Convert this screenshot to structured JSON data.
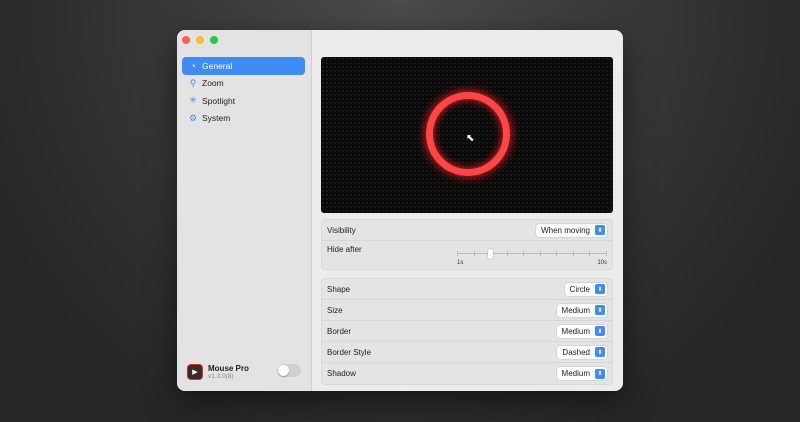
{
  "sidebar": {
    "items": [
      {
        "label": "General",
        "icon": "gauge-icon",
        "glyph": "◔"
      },
      {
        "label": "Zoom",
        "icon": "zoom-icon",
        "glyph": "⚲"
      },
      {
        "label": "Spotlight",
        "icon": "spotlight-icon",
        "glyph": "✳"
      },
      {
        "label": "System",
        "icon": "gear-icon",
        "glyph": "⚙"
      }
    ],
    "app": {
      "name": "Mouse Pro",
      "version": "v1.3.0(8)",
      "enabled": false
    }
  },
  "visibility": {
    "label": "Visibility",
    "value": "When moving"
  },
  "hide_after": {
    "label": "Hide after",
    "min_label": "1s",
    "max_label": "10s",
    "min": 1,
    "max": 10,
    "value": 3
  },
  "settings": [
    {
      "label": "Shape",
      "value": "Circle"
    },
    {
      "label": "Size",
      "value": "Medium"
    },
    {
      "label": "Border",
      "value": "Medium"
    },
    {
      "label": "Border Style",
      "value": "Dashed"
    },
    {
      "label": "Shadow",
      "value": "Medium"
    }
  ],
  "colors": {
    "accent": "#3f8cf5",
    "ring": "#ff4545"
  }
}
